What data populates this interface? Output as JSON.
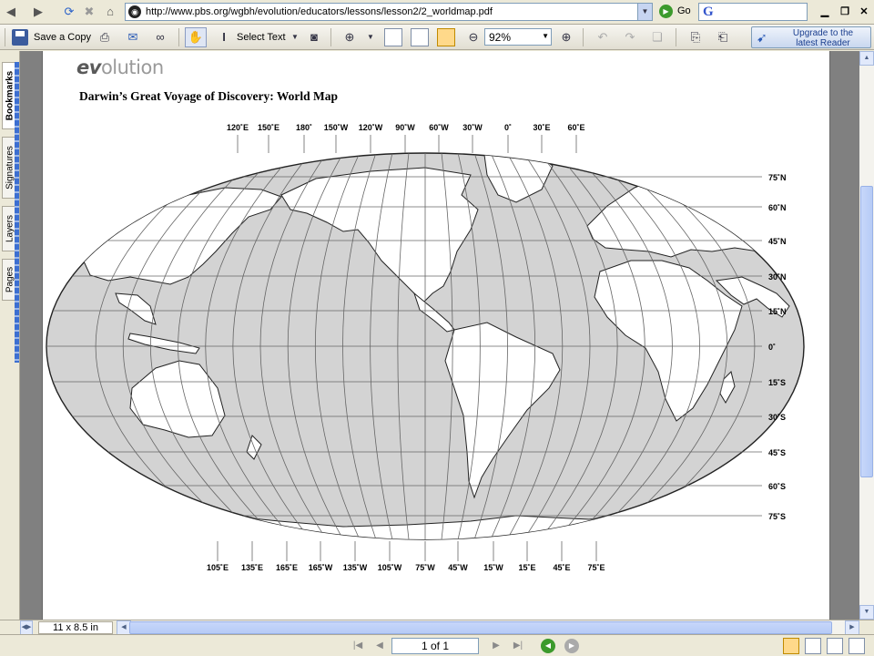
{
  "browser": {
    "url": "http://www.pbs.org/wgbh/evolution/educators/lessons/lesson2/2_worldmap.pdf",
    "go_label": "Go",
    "google_logo": "G"
  },
  "toolbar": {
    "save_label": "Save a Copy",
    "select_text_label": "Select Text",
    "zoom_value": "92%",
    "upgrade_label": "Upgrade to the\nlatest Reader"
  },
  "side_tabs": [
    "Bookmarks",
    "Signatures",
    "Layers",
    "Pages"
  ],
  "document": {
    "logo_prefix": "ev",
    "logo_suffix": "olution",
    "title": "Darwin’s Great Voyage of Discovery: World Map",
    "top_longitudes": [
      "120˚E",
      "150˚E",
      "180˚",
      "150˚W",
      "120˚W",
      "90˚W",
      "60˚W",
      "30˚W",
      "0˚",
      "30˚E",
      "60˚E"
    ],
    "bottom_longitudes": [
      "105˚E",
      "135˚E",
      "165˚E",
      "165˚W",
      "135˚W",
      "105˚W",
      "75˚W",
      "45˚W",
      "15˚W",
      "15˚E",
      "45˚E",
      "75˚E"
    ],
    "latitudes": [
      "75˚N",
      "60˚N",
      "45˚N",
      "30˚N",
      "15˚N",
      "0˚",
      "15˚S",
      "30˚S",
      "45˚S",
      "60˚S",
      "75˚S"
    ]
  },
  "status": {
    "page_size": "11 x 8.5 in"
  },
  "navigation": {
    "page_indicator": "1 of 1"
  }
}
